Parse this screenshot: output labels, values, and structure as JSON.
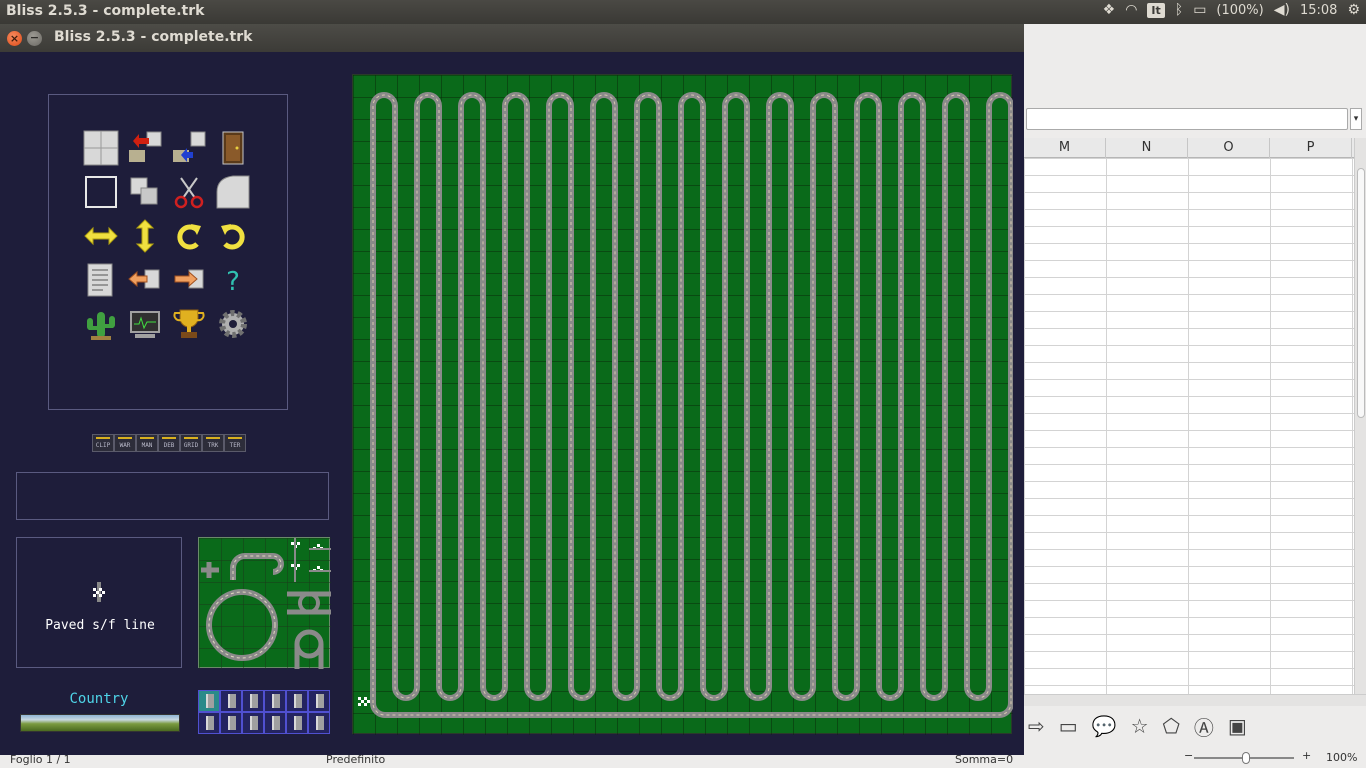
{
  "top_panel": {
    "app_title": "Bliss 2.5.3 - complete.trk",
    "keyboard_layout": "It",
    "battery": "(100%)",
    "clock": "15:08"
  },
  "bliss": {
    "window_title": "Bliss 2.5.3 - complete.trk",
    "mode_buttons": [
      "CLIP",
      "WAR",
      "MAN",
      "DEB",
      "GRID",
      "TRK",
      "TER"
    ],
    "selected_piece": "Paved s/f line",
    "scenery": "Country",
    "message": ""
  },
  "calc": {
    "columns": [
      "M",
      "N",
      "O",
      "P"
    ],
    "zoom": "100%",
    "status_sheet": "Foglio 1 / 1",
    "status_style": "Predefinito",
    "status_sum": "Somma=0"
  },
  "colors": {
    "board_green": "#0a6a1a",
    "bliss_bg": "#1e1d3a",
    "scenery_text": "#4fd4e8"
  }
}
